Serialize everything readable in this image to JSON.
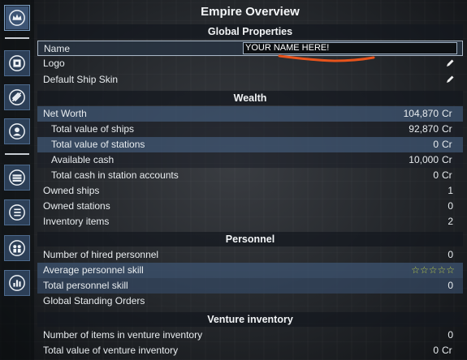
{
  "sidebar": {
    "buttons": [
      {
        "icon": "crown-icon"
      },
      {
        "icon": "faction-icon"
      },
      {
        "icon": "propulsion-icon"
      },
      {
        "icon": "crew-icon"
      },
      {
        "icon": "ship-stack-icon"
      },
      {
        "icon": "list-icon"
      },
      {
        "icon": "personnel-icon"
      },
      {
        "icon": "stats-chart-icon"
      }
    ]
  },
  "header": {
    "title": "Empire Overview"
  },
  "sections": {
    "global": "Global Properties",
    "wealth": "Wealth",
    "personnel": "Personnel",
    "venture": "Venture inventory"
  },
  "global": {
    "name_label": "Name",
    "name_value": "YOUR NAME HERE!",
    "logo_label": "Logo",
    "skin_label": "Default Ship Skin"
  },
  "wealth": {
    "net_worth_label": "Net Worth",
    "net_worth_value": "104,870",
    "ships_label": "Total value of ships",
    "ships_value": "92,870",
    "stations_label": "Total value of stations",
    "stations_value": "0",
    "cash_label": "Available cash",
    "cash_value": "10,000",
    "accounts_label": "Total cash in station accounts",
    "accounts_value": "0",
    "owned_ships_label": "Owned ships",
    "owned_ships_value": "1",
    "owned_stations_label": "Owned stations",
    "owned_stations_value": "0",
    "inventory_label": "Inventory items",
    "inventory_value": "2",
    "currency": "Cr"
  },
  "personnel": {
    "hired_label": "Number of hired personnel",
    "hired_value": "0",
    "avg_skill_label": "Average personnel skill",
    "avg_skill_stars": "☆☆☆☆☆",
    "total_skill_label": "Total personnel skill",
    "total_skill_value": "0",
    "orders_label": "Global Standing Orders"
  },
  "venture": {
    "items_label": "Number of items in venture inventory",
    "items_value": "0",
    "value_label": "Total value of venture inventory",
    "value_value": "0",
    "currency": "Cr"
  },
  "colors": {
    "row_highlight": "#3c526e",
    "annotation_underline": "#e8541c",
    "stars": "#b8c84a"
  }
}
